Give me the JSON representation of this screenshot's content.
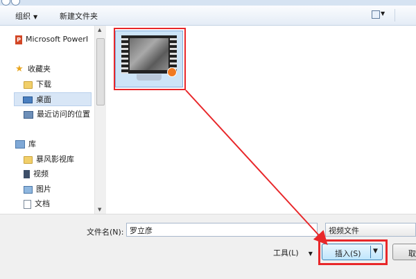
{
  "toolbar": {
    "organize_label": "组织",
    "new_folder_label": "新建文件夹"
  },
  "nav": {
    "items": [
      {
        "label": "Microsoft PowerI",
        "icon": "powerpoint-icon"
      },
      {
        "label": "收藏夹",
        "icon": "star-icon"
      },
      {
        "label": "下载",
        "icon": "folder-icon"
      },
      {
        "label": "桌面",
        "icon": "desktop-icon"
      },
      {
        "label": "最近访问的位置",
        "icon": "recent-places-icon"
      },
      {
        "label": "库",
        "icon": "library-icon"
      },
      {
        "label": "暴风影视库",
        "icon": "folder-icon"
      },
      {
        "label": "视频",
        "icon": "video-library-icon"
      },
      {
        "label": "图片",
        "icon": "pictures-icon"
      },
      {
        "label": "文档",
        "icon": "documents-icon"
      }
    ]
  },
  "file": {
    "icon": "video-file-thumbnail-icon"
  },
  "footer": {
    "filename_label": "文件名(N):",
    "filename_value": "罗立彦",
    "filetype_value": "视频文件",
    "tools_label": "工具(L)",
    "insert_label": "插入(S)",
    "cancel_label": "取"
  },
  "colors": {
    "highlight_red": "#e8272a",
    "selection_blue": "#cde4f7",
    "toolbar_bg": "#e4ecf6"
  }
}
